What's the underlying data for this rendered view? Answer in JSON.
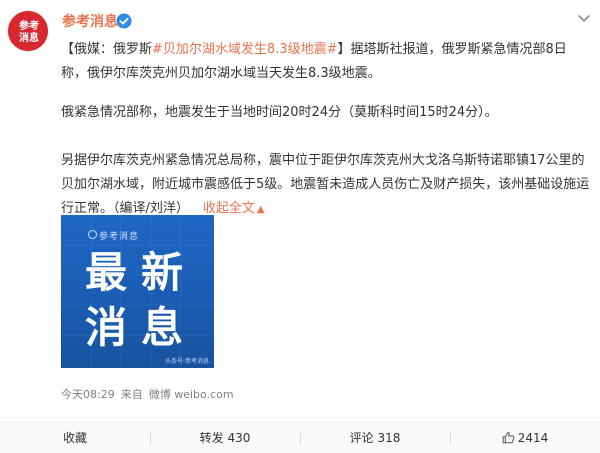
{
  "author": {
    "name": "参考消息",
    "verified_icon": "verified-badge-icon",
    "avatar_text": [
      "参",
      "考",
      "消",
      "息"
    ]
  },
  "post": {
    "bracket_open": "【",
    "source_prefix": "俄媒：俄罗斯",
    "topic_link": "#贝加尔湖水域发生8.3级地震#",
    "bracket_close": "】",
    "para1_rest": "据塔斯社报道，俄罗斯紧急情况部8日称，俄伊尔库茨克州贝加尔湖水域当天发生8.3级地震。",
    "para2": "俄紧急情况部称，地震发生于当地时间20时24分（莫斯科时间15时24分）。",
    "para3": "另据伊尔库茨克州紧急情况总局称，震中位于距伊尔库茨克州大戈洛乌斯特诺耶镇17公里的贝加尔湖水域，附近城市震感低于5级。地震暂未造成人员伤亡及财产损失，该州基础设施运行正常。（编译/刘洋）",
    "collapse_label": "收起全文",
    "collapse_icon": "chevron-up-icon"
  },
  "image": {
    "brand": "参考消息",
    "chars": [
      "最",
      "新",
      "消",
      "息"
    ],
    "watermark": "头条号:参考消息"
  },
  "meta": {
    "time": "今天08:29",
    "from_label": "来自",
    "source": "微博 weibo.com"
  },
  "footer": {
    "favorite_label": "收藏",
    "repost_label": "转发 430",
    "comment_label": "评论 318",
    "like_count": "2414",
    "like_icon": "thumbs-up-icon"
  },
  "colors": {
    "accent": "#eb7350",
    "brand_red": "#d8282f",
    "image_blue": "#1e67c4",
    "meta_gray": "#808080"
  }
}
